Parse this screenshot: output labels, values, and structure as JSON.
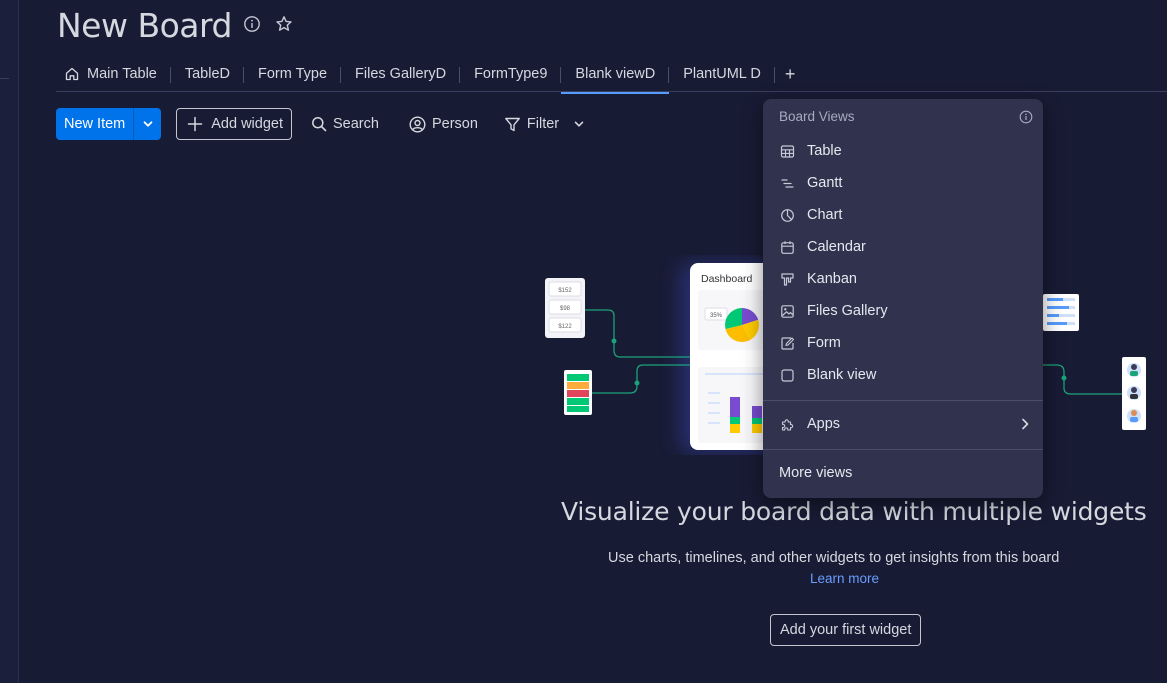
{
  "board": {
    "title": "New Board"
  },
  "tabs": [
    {
      "label": "Main Table",
      "icon": "home-icon"
    },
    {
      "label": "TableD"
    },
    {
      "label": "Form Type"
    },
    {
      "label": "Files GalleryD"
    },
    {
      "label": "FormType9"
    },
    {
      "label": "Blank viewD",
      "active": true
    },
    {
      "label": "PlantUML D"
    },
    {
      "label": "+"
    }
  ],
  "toolbar": {
    "new_item": "New Item",
    "add_widget": "Add widget",
    "search": "Search",
    "person": "Person",
    "filter": "Filter"
  },
  "illustration": {
    "dashboard_label": "Dashboard",
    "pie_label": "35%",
    "card_values": [
      "$152",
      "$98",
      "$122"
    ]
  },
  "empty_state": {
    "title": "Visualize your board data with multiple widgets",
    "subtitle": "Use charts, timelines, and other widgets to get insights from this board",
    "learn_more": "Learn more",
    "cta": "Add your first widget"
  },
  "menu": {
    "header": "Board Views",
    "items": [
      {
        "label": "Table",
        "icon": "table-icon"
      },
      {
        "label": "Gantt",
        "icon": "gantt-icon"
      },
      {
        "label": "Chart",
        "icon": "chart-icon"
      },
      {
        "label": "Calendar",
        "icon": "calendar-icon"
      },
      {
        "label": "Kanban",
        "icon": "kanban-icon"
      },
      {
        "label": "Files Gallery",
        "icon": "gallery-icon"
      },
      {
        "label": "Form",
        "icon": "form-icon"
      },
      {
        "label": "Blank view",
        "icon": "blank-view-icon"
      }
    ],
    "apps": "Apps",
    "more_views": "More views"
  },
  "colors": {
    "background": "#181b34",
    "primary": "#0073ea",
    "active_tab": "#579bfc",
    "menu_bg": "#30324e",
    "link": "#6b9cff"
  }
}
